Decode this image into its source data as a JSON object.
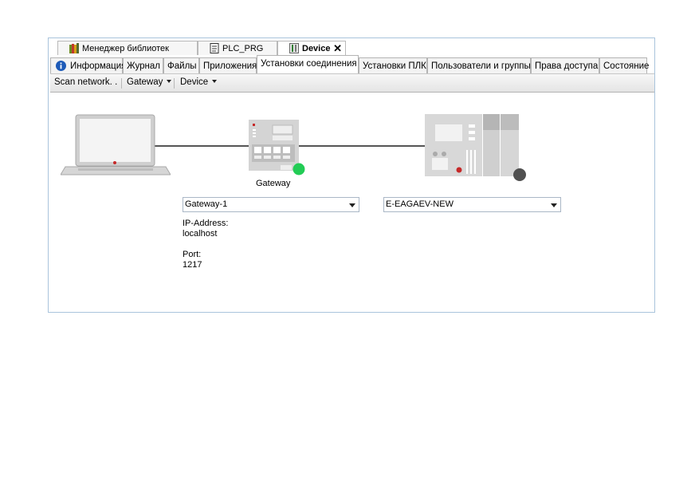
{
  "editor_tabs": [
    {
      "label": "Менеджер библиотек",
      "icon": "library-manager-icon"
    },
    {
      "label": "PLC_PRG",
      "icon": "program-file-icon"
    },
    {
      "label": "Device",
      "icon": "device-icon",
      "active": true
    }
  ],
  "sub_tabs": [
    {
      "label": "Информация",
      "icon": "info-icon"
    },
    {
      "label": "Журнал"
    },
    {
      "label": "Файлы"
    },
    {
      "label": "Приложения"
    },
    {
      "label": "Установки соединения",
      "active": true
    },
    {
      "label": "Установки ПЛК"
    },
    {
      "label": "Пользователи и группы"
    },
    {
      "label": "Права доступа"
    },
    {
      "label": "Состояние"
    }
  ],
  "toolbar": {
    "scan_label": "Scan network. .",
    "gateway_label": "Gateway",
    "device_label": "Device"
  },
  "diagram": {
    "gateway_caption": "Gateway",
    "gateway_status_color": "#22cc55",
    "device_status_color": "#505050"
  },
  "gateway": {
    "selected": "Gateway-1",
    "ip_label": "IP-Address:",
    "ip_value": "localhost",
    "port_label": "Port:",
    "port_value": "1217"
  },
  "device": {
    "selected": "E-EAGAEV-NEW"
  }
}
